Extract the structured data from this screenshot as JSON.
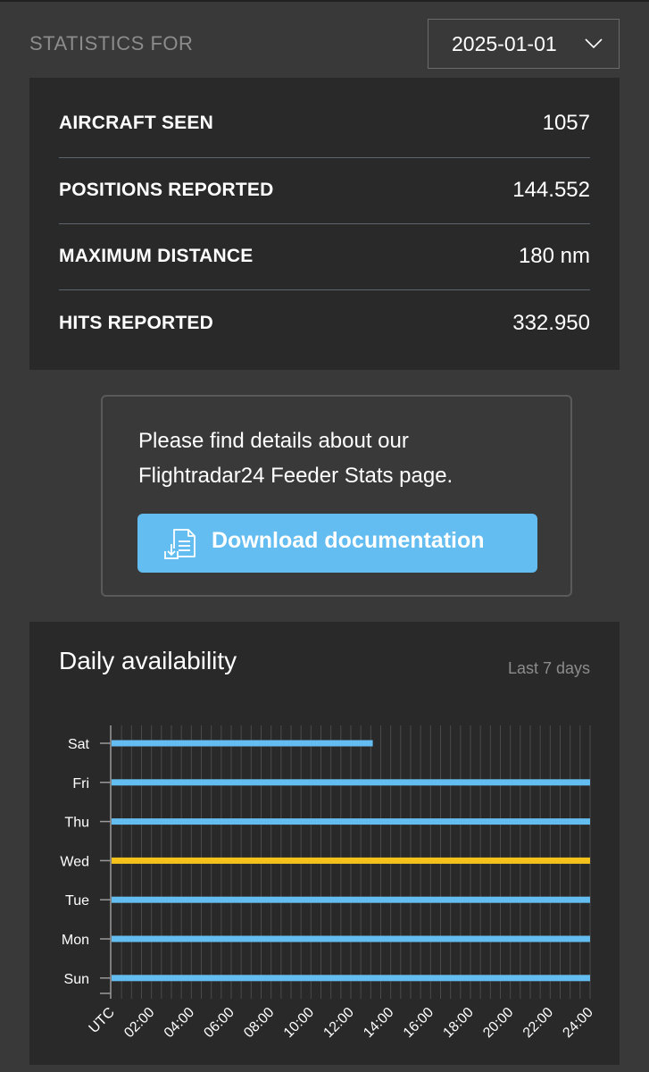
{
  "header": {
    "label": "STATISTICS FOR",
    "date_value": "2025-01-01"
  },
  "stats": [
    {
      "label": "AIRCRAFT SEEN",
      "value": "1057"
    },
    {
      "label": "POSITIONS REPORTED",
      "value": "144.552"
    },
    {
      "label": "MAXIMUM DISTANCE",
      "value": "180 nm"
    },
    {
      "label": "HITS REPORTED",
      "value": "332.950"
    }
  ],
  "doc": {
    "text_line1": "Please find details about our",
    "text_line2": "Flightradar24 Feeder Stats page.",
    "button_label": "Download documentation"
  },
  "availability": {
    "title": "Daily availability",
    "range": "Last 7 days"
  },
  "colors": {
    "bar_blue": "#64bdf0",
    "bar_yellow": "#f5c21b",
    "button_blue": "#64bdf0"
  },
  "chart_data": {
    "type": "bar",
    "orientation": "horizontal",
    "categories": [
      "Sat",
      "Fri",
      "Thu",
      "Wed",
      "Tue",
      "Mon",
      "Sun"
    ],
    "x_ticks": [
      "UTC",
      "02:00",
      "04:00",
      "06:00",
      "08:00",
      "10:00",
      "12:00",
      "14:00",
      "16:00",
      "18:00",
      "20:00",
      "22:00",
      "24:00"
    ],
    "xlim": [
      0,
      24
    ],
    "series": [
      {
        "ranges": [
          [
            0,
            13.1
          ],
          [
            0,
            24
          ],
          [
            0,
            24
          ],
          [
            0,
            24
          ],
          [
            0,
            24
          ],
          [
            0,
            24
          ],
          [
            0,
            24
          ]
        ],
        "highlight": [
          false,
          false,
          false,
          true,
          false,
          false,
          false
        ]
      }
    ],
    "grid": true
  }
}
